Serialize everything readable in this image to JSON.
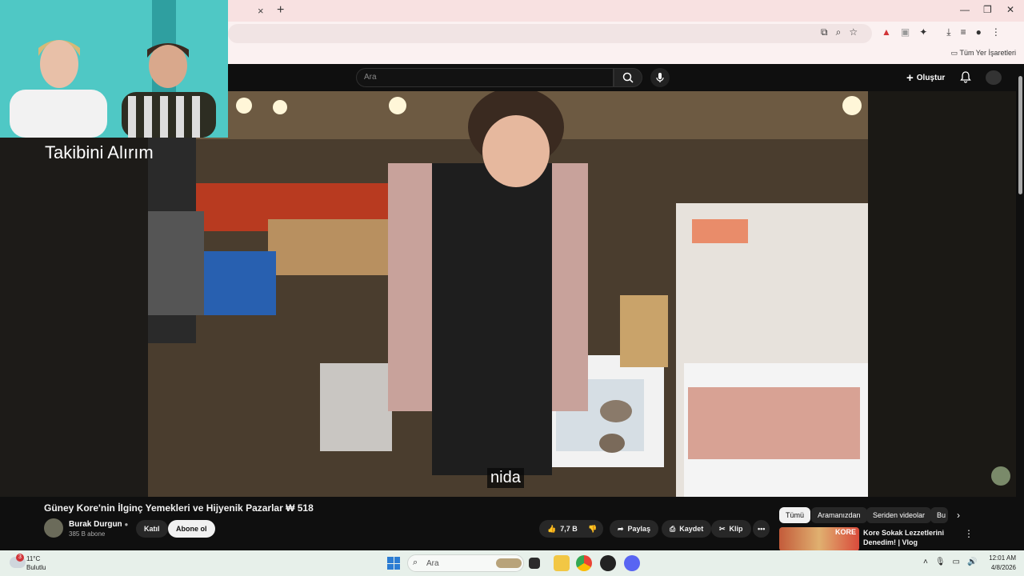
{
  "browser": {
    "tab_close": "×",
    "tab_new": "+",
    "window_controls": [
      "—",
      "❐",
      "✕"
    ],
    "bookmarks_all": "Tüm Yer İşaretleri"
  },
  "youtube": {
    "search_placeholder": "Ara",
    "create_label": "Oluştur",
    "video": {
      "overlay_caption": "Takibini Alırım",
      "subtitle": "nida",
      "title": "Güney Kore'nin İlginç Yemekleri ve Hijyenik Pazarlar ₩ 518"
    },
    "channel": {
      "name": "Burak Durgun",
      "subscribers": "385 B abone",
      "join_label": "Katıl",
      "subscribe_label": "Abone ol"
    },
    "actions": {
      "likes": "7,7 B",
      "share": "Paylaş",
      "save": "Kaydet",
      "clip": "Klip"
    },
    "chips": [
      "Tümü",
      "Aramanızdan",
      "Seriden videolar",
      "Bu"
    ],
    "recommendation": {
      "thumb_text": "KORE",
      "title": "Kore Sokak Lezzetlerini Denedim! | Vlog"
    }
  },
  "taskbar": {
    "weather_badge": "3",
    "temperature": "11°C",
    "condition": "Bulutlu",
    "search_placeholder": "Ara",
    "time": "12:01 AM",
    "date": "4/8/2026"
  },
  "colors": {
    "youtube_bg": "#0f0f0f",
    "tabbar": "#f8e1e1",
    "webcam_bg": "#58d0cb",
    "taskbar": "#e7f0ea"
  }
}
